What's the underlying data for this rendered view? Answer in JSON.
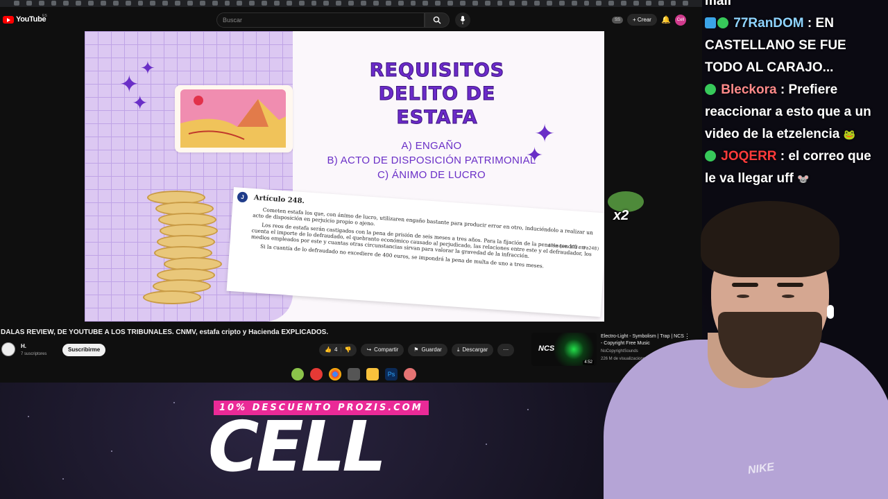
{
  "youtube": {
    "logo_text": "YouTube",
    "region": "ES",
    "search_placeholder": "Buscar",
    "account_initials": "SS",
    "create_label": "Crear",
    "avatar_text": "Cell"
  },
  "slide": {
    "title_lines": [
      "REQUISITOS",
      "DELITO DE",
      "ESTAFA"
    ],
    "items": [
      "A) ENGAÑO",
      "B) ACTO DE DISPOSICIÓN PATRIMONIAL",
      "C) ÁNIMO DE LUCRO"
    ],
    "article_badge": "J",
    "article_title": "Artículo 248.",
    "article_ref": "(Bloque 373: #a248)",
    "article_paragraphs": [
      "Cometen estafa los que, con ánimo de lucro, utilizaren engaño bastante para producir error en otro, induciéndolo a realizar un acto de disposición en perjuicio propio o ajeno.",
      "Los reos de estafa serán castigados con la pena de prisión de seis meses a tres años. Para la fijación de la pena se tendrá en cuenta el importe de lo defraudado, el quebranto económico causado al perjudicado, las relaciones entre este y el defraudador, los medios empleados por este y cuantas otras circunstancias sirvan para valorar la gravedad de la infracción.",
      "Si la cuantía de lo defraudado no excediere de 400 euros, se impondrá la pena de multa de uno a tres meses."
    ]
  },
  "video": {
    "title": "DALAS REVIEW, DE YOUTUBE A LOS TRIBUNALES. CNMV, estafa cripto y Hacienda EXPLICADOS.",
    "channel_name": "H.",
    "subscribers": "7 suscriptores",
    "subscribe_label": "Suscribirme",
    "likes": "4",
    "share_label": "Compartir",
    "save_label": "Guardar",
    "download_label": "Descargar"
  },
  "recommended": {
    "title": "Electro-Light - Symbolism | Trap | NCS - Copyright Free Music",
    "channel": "NoCopyrightSounds",
    "views": "226 M de visualizaciones",
    "duration": "4:52",
    "thumb_text": "NCS"
  },
  "chat": [
    {
      "user": "",
      "text": "mall",
      "color": "#ffffff"
    },
    {
      "user": "77RanDOM",
      "text": "EN CASTELLANO SE FUE TODO AL CARAJO...",
      "color": "#8fd4ff"
    },
    {
      "user": "Bleckora",
      "text": "Prefiere reaccionar a esto que a un video de la etzelencia",
      "color": "#ff8a8a"
    },
    {
      "user": "JOQERR",
      "text": "el correo que le va llegar uff",
      "color": "#ff3b3b"
    }
  ],
  "overlay": {
    "emote_multiplier": "x2",
    "promo_text": "10% DESCUENTO PROZIS.COM",
    "promo_code": "CELL",
    "shirt_brand": "NIKE"
  },
  "colors": {
    "slide_purple": "#6b2bc9",
    "promo_pink": "#ea2a97",
    "youtube_red": "#ff0000"
  }
}
